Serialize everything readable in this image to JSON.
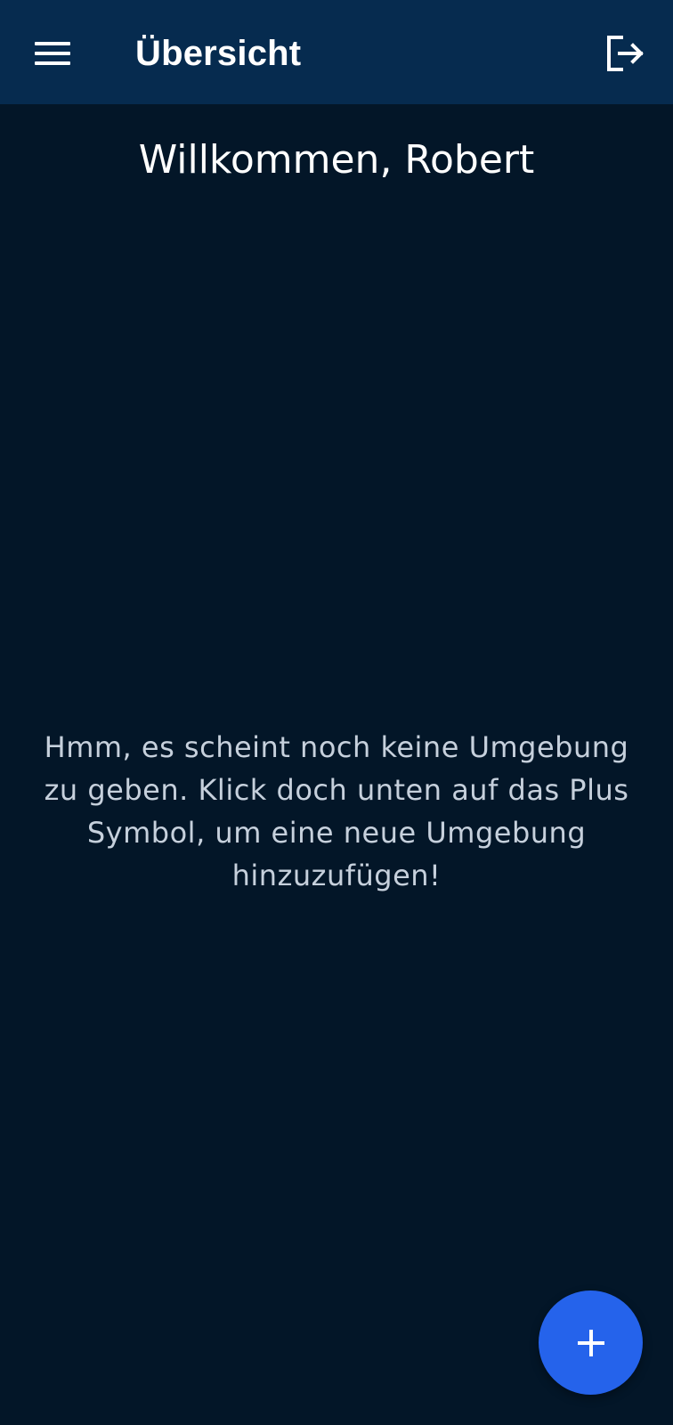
{
  "app_bar": {
    "title": "Übersicht",
    "background": "#062b4f",
    "menu_icon": "hamburger-menu-icon",
    "logout_icon": "logout-icon"
  },
  "main": {
    "welcome": "Willkommen, Robert",
    "empty_state": "Hmm, es scheint noch keine Umgebung zu geben. Klick doch unten auf das Plus Symbol, um eine neue Umgebung hinzuzufügen!",
    "background": "#031628"
  },
  "fab": {
    "icon": "plus-icon",
    "color": "#2563eb"
  }
}
